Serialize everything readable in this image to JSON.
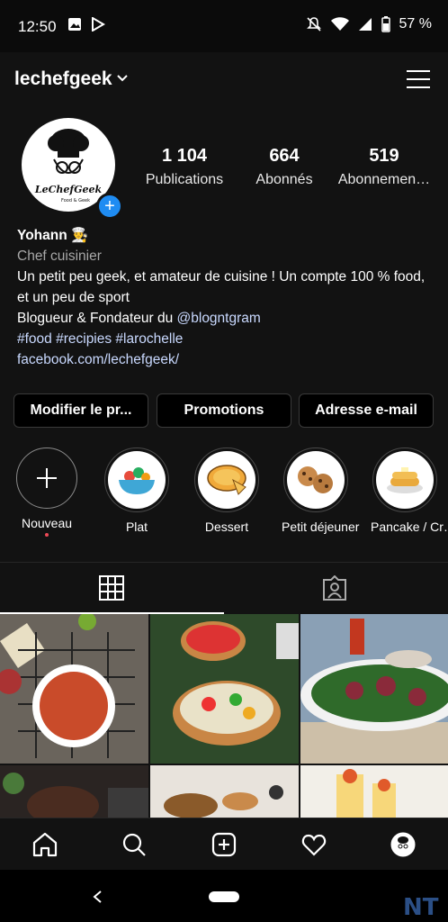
{
  "status_bar": {
    "time": "12:50",
    "battery": "57 %"
  },
  "header": {
    "username": "lechefgeek"
  },
  "avatar": {
    "logo_line1": "LeChefGeek",
    "logo_line2": "Food & Geek"
  },
  "stats": [
    {
      "value": "1 104",
      "label": "Publications"
    },
    {
      "value": "664",
      "label": "Abonnés"
    },
    {
      "value": "519",
      "label": "Abonnemen…"
    }
  ],
  "bio": {
    "name": "Yohann 👨‍🍳",
    "category": "Chef cuisinier",
    "line1": "Un petit peu geek, et amateur de cuisine ! Un compte 100 % food, et un peu de sport",
    "line2_prefix": "Blogueur & Fondateur du ",
    "mention": "@blogntgram",
    "hashtags": "#food #recipies #larochelle",
    "link": "facebook.com/lechefgeek/"
  },
  "buttons": {
    "edit": "Modifier le pr...",
    "promotions": "Promotions",
    "email": "Adresse e-mail"
  },
  "highlights": [
    {
      "label": "Nouveau",
      "icon": "plus-icon"
    },
    {
      "label": "Plat",
      "icon": "salad-bowl-icon"
    },
    {
      "label": "Dessert",
      "icon": "pie-icon"
    },
    {
      "label": "Petit déjeuner",
      "icon": "cookies-icon"
    },
    {
      "label": "Pancake / Cr…",
      "icon": "pancake-icon"
    }
  ],
  "tabs": [
    {
      "name": "grid",
      "icon": "grid-icon",
      "active": true
    },
    {
      "name": "tagged",
      "icon": "tagged-person-icon",
      "active": false
    }
  ],
  "bottom_nav": [
    "home-icon",
    "search-icon",
    "new-post-icon",
    "heart-icon",
    "profile-avatar"
  ],
  "colors": {
    "background": "#121212",
    "link": "#c9d9ff",
    "accent": "#1f8cf2",
    "notif_dot": "#ed4956"
  }
}
